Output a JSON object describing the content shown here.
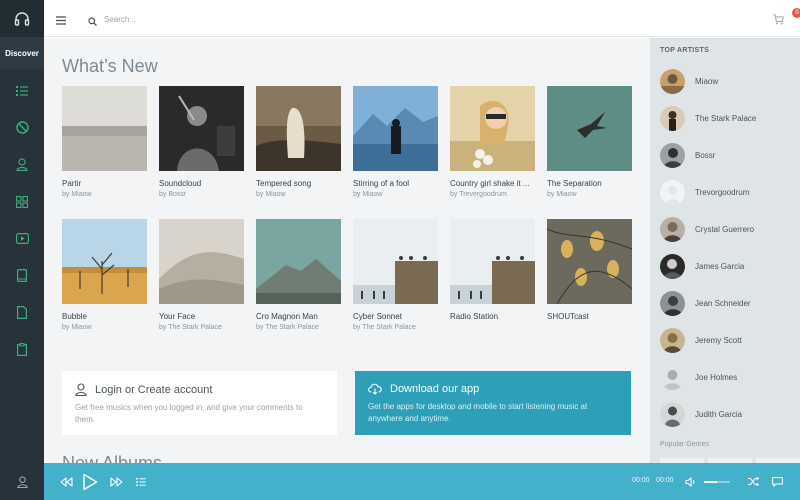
{
  "nav": {
    "discover_label": "Discover",
    "items": [
      {
        "icon": "list-icon"
      },
      {
        "icon": "disc-icon",
        "active": true
      },
      {
        "icon": "user-icon"
      },
      {
        "icon": "grid-icon"
      },
      {
        "icon": "video-icon"
      },
      {
        "icon": "tablet-icon"
      },
      {
        "icon": "file-icon"
      },
      {
        "icon": "clipboard-icon"
      }
    ]
  },
  "header": {
    "search_placeholder": "Search...",
    "cart_count": "0"
  },
  "main": {
    "title": "What’s New",
    "albums": [
      {
        "title": "Partir",
        "artist": "by Miaow"
      },
      {
        "title": "Soundcloud",
        "artist": "by Bossr"
      },
      {
        "title": "Tempered song",
        "artist": "by Miaow"
      },
      {
        "title": "Stirring of a fool",
        "artist": "by Miaow"
      },
      {
        "title": "Country girl shake it ...",
        "artist": "by Trevergoodrum"
      },
      {
        "title": "The Separation",
        "artist": "by Miaow"
      },
      {
        "title": "Bubble",
        "artist": "by Miaow"
      },
      {
        "title": "Your Face",
        "artist": "by The Stark Palace"
      },
      {
        "title": "Cro Magnon Man",
        "artist": "by The Stark Palace"
      },
      {
        "title": "Cyber Sonnet",
        "artist": "by The Stark Palace"
      },
      {
        "title": "Radio Station",
        "artist": ""
      },
      {
        "title": "SHOUTcast",
        "artist": ""
      }
    ],
    "login_panel": {
      "title": "Login or Create account",
      "description": "Get free musics when you logged in, and give your comments to them."
    },
    "download_panel": {
      "title": "Download our app",
      "description": "Get the apps for desktop and mobile to start listening music at anywhere and anytime."
    },
    "next_section_peek": "New Albums"
  },
  "sidebar": {
    "heading": "TOP ARTISTS",
    "artists": [
      {
        "name": "Miaow"
      },
      {
        "name": "The Stark Palace"
      },
      {
        "name": "Bossr"
      },
      {
        "name": "Trevorgoodrum"
      },
      {
        "name": "Crystal Guerrero"
      },
      {
        "name": "James Garcia"
      },
      {
        "name": "Jean Schneider"
      },
      {
        "name": "Jeremy Scott"
      },
      {
        "name": "Joe Holmes"
      },
      {
        "name": "Judith Garcia"
      }
    ],
    "genres_heading": "Popular Genres"
  },
  "player": {
    "current_time": "00:00",
    "duration": "00:00",
    "volume": 0.5
  },
  "colors": {
    "accent": "#43b1c9",
    "download_panel": "#2e9fb8",
    "nav_bg": "#27323a",
    "active_icon": "#3ab07c",
    "badge": "#e25b4f"
  }
}
